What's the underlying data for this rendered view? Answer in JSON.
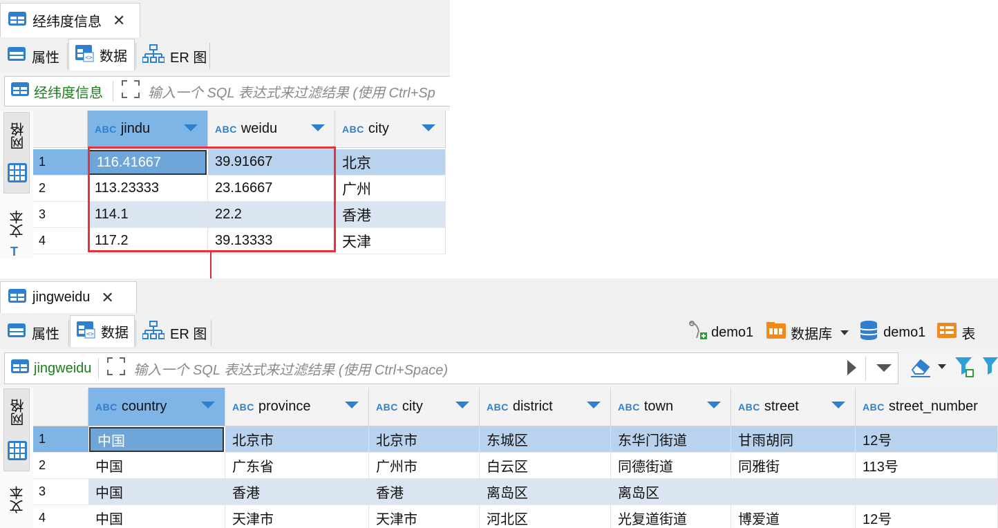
{
  "top": {
    "tab_title": "经纬度信息",
    "subtabs": [
      "属性",
      "数据",
      "ER 图"
    ],
    "filter_table": "经纬度信息",
    "filter_placeholder": "输入一个 SQL 表达式来过滤结果 (使用 Ctrl+Sp",
    "side_tabs": [
      "网格",
      "文本"
    ],
    "columns": [
      "jindu",
      "weidu",
      "city"
    ],
    "rows": [
      {
        "n": "1",
        "cells": [
          "116.41667",
          "39.91667",
          "北京"
        ]
      },
      {
        "n": "2",
        "cells": [
          "113.23333",
          "23.16667",
          "广州"
        ]
      },
      {
        "n": "3",
        "cells": [
          "114.1",
          "22.2",
          "香港"
        ]
      },
      {
        "n": "4",
        "cells": [
          "117.2",
          "39.13333",
          "天津"
        ]
      }
    ]
  },
  "bottom": {
    "tab_title": "jingweidu",
    "subtabs": [
      "属性",
      "数据",
      "ER 图"
    ],
    "right_items": [
      "demo1",
      "数据库",
      "demo1",
      "表"
    ],
    "filter_table": "jingweidu",
    "filter_placeholder": "输入一个 SQL 表达式来过滤结果 (使用 Ctrl+Space)",
    "side_tabs": [
      "网格",
      "文本"
    ],
    "columns": [
      "country",
      "province",
      "city",
      "district",
      "town",
      "street",
      "street_number"
    ],
    "rows": [
      {
        "n": "1",
        "cells": [
          "中国",
          "北京市",
          "北京市",
          "东城区",
          "东华门街道",
          "甘雨胡同",
          "12号"
        ]
      },
      {
        "n": "2",
        "cells": [
          "中国",
          "广东省",
          "广州市",
          "白云区",
          "同德街道",
          "同雅街",
          "113号"
        ]
      },
      {
        "n": "3",
        "cells": [
          "中国",
          "香港",
          "香港",
          "离岛区",
          "离岛区",
          "",
          ""
        ]
      },
      {
        "n": "4",
        "cells": [
          "中国",
          "天津市",
          "天津市",
          "河北区",
          "光复道街道",
          "博爱道",
          "12号"
        ]
      }
    ]
  },
  "colors": {
    "highlight_box": "#e8313b",
    "arrow": "#d32f2f",
    "selected_header": "#7fb4e6",
    "filter_name": "#1a7f1a"
  }
}
